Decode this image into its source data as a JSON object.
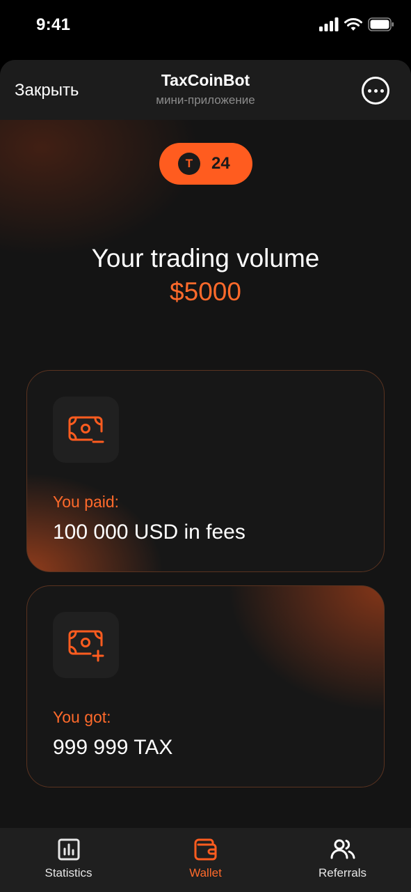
{
  "status_bar": {
    "time": "9:41",
    "icons": [
      "signal-icon",
      "wifi-icon",
      "battery-icon"
    ]
  },
  "header": {
    "close_label": "Закрыть",
    "title": "TaxCoinBot",
    "subtitle": "мини-приложение",
    "more_icon": "more-dots-icon"
  },
  "coin": {
    "symbol": "T",
    "count": "24"
  },
  "volume": {
    "title": "Your trading volume",
    "value": "$5000"
  },
  "cards": [
    {
      "icon": "cash-minus-icon",
      "label": "You paid:",
      "value": "100 000 USD in fees"
    },
    {
      "icon": "cash-plus-icon",
      "label": "You got:",
      "value": "999 999 TAX"
    }
  ],
  "tabs": [
    {
      "label": "Statistics",
      "icon": "statistics-icon",
      "active": false
    },
    {
      "label": "Wallet",
      "icon": "wallet-icon",
      "active": true
    },
    {
      "label": "Referrals",
      "icon": "referrals-icon",
      "active": false
    }
  ],
  "colors": {
    "accent": "#ff5c1f",
    "accent_text": "#ff6a2b",
    "background": "#141414",
    "card": "#171717"
  }
}
